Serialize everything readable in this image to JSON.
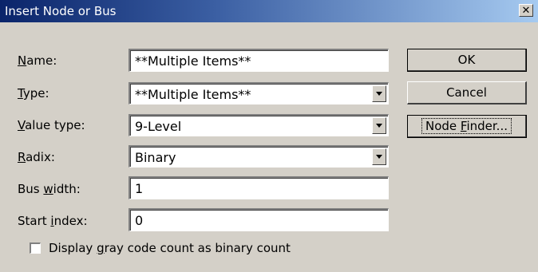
{
  "window": {
    "title": "Insert Node or Bus",
    "close_glyph": "✕"
  },
  "fields": {
    "name": {
      "label_prefix": "",
      "label_mnemonic": "N",
      "label_rest": "ame:",
      "value": "**Multiple Items**"
    },
    "type": {
      "label_prefix": "",
      "label_mnemonic": "T",
      "label_rest": "ype:",
      "value": "**Multiple Items**"
    },
    "value_type": {
      "label_prefix": "",
      "label_mnemonic": "V",
      "label_rest": "alue type:",
      "value": "9-Level"
    },
    "radix": {
      "label_prefix": "",
      "label_mnemonic": "R",
      "label_rest": "adix:",
      "value": "Binary"
    },
    "bus_width": {
      "label_prefix": "Bus ",
      "label_mnemonic": "w",
      "label_rest": "idth:",
      "value": "1"
    },
    "start_index": {
      "label_prefix": "Start ",
      "label_mnemonic": "i",
      "label_rest": "ndex:",
      "value": "0"
    }
  },
  "buttons": {
    "ok": "OK",
    "cancel": "Cancel",
    "node_finder_prefix": "Node ",
    "node_finder_mnemonic": "F",
    "node_finder_rest": "inder..."
  },
  "checkbox": {
    "label_prefix": "Display ",
    "label_mnemonic": "g",
    "label_rest": "ray code count as binary count",
    "checked": false
  }
}
